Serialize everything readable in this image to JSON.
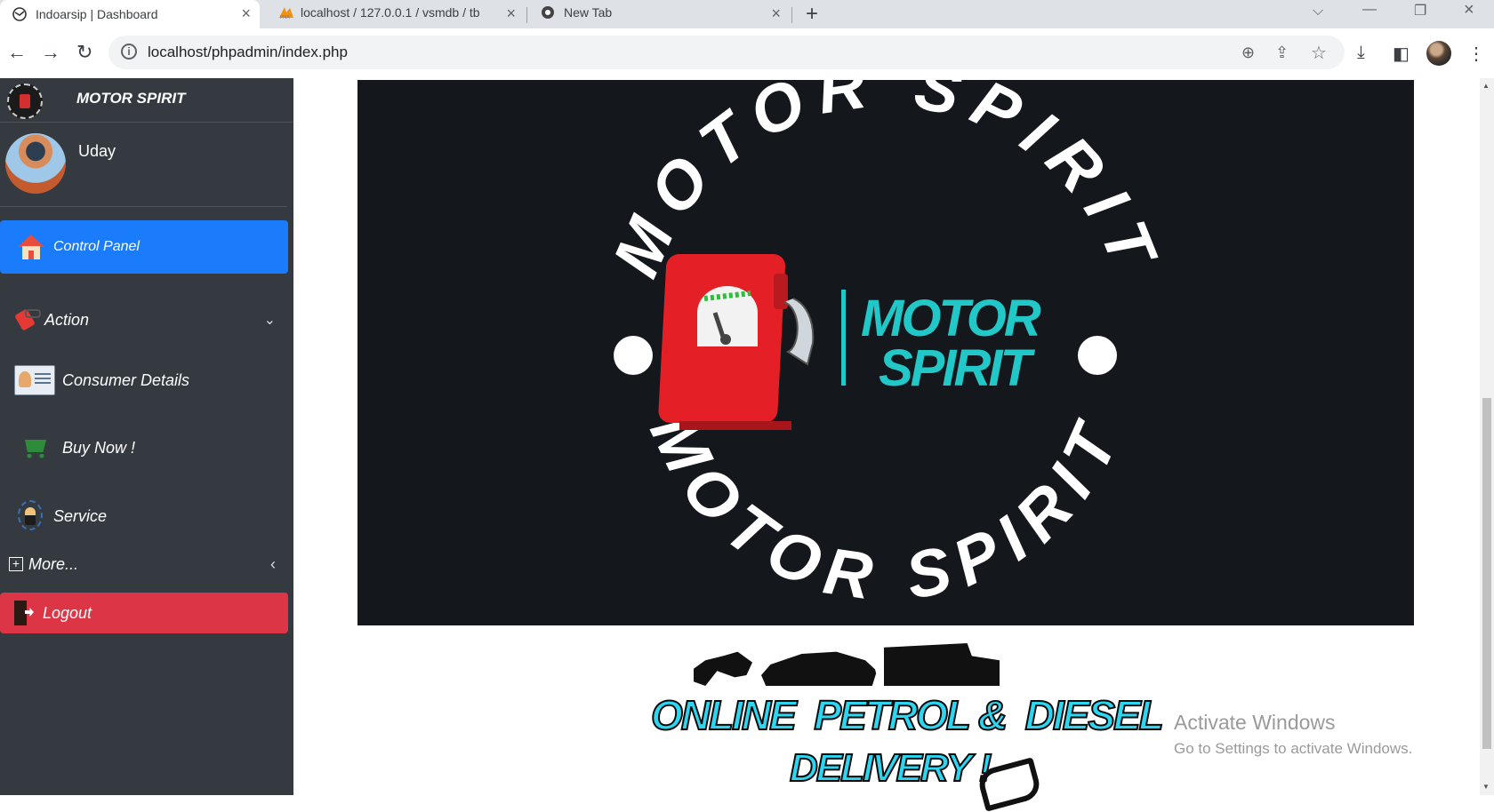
{
  "browser": {
    "tabs": [
      {
        "title": "Indoarsip | Dashboard",
        "active": true
      },
      {
        "title": "localhost / 127.0.0.1 / vsmdb / tb",
        "active": false
      },
      {
        "title": "New Tab",
        "active": false
      }
    ],
    "url": "localhost/phpadmin/index.php"
  },
  "sidebar": {
    "brand": "MOTOR SPIRIT",
    "user_name": "Uday",
    "items": [
      {
        "label": "Control Panel",
        "icon": "house-icon"
      },
      {
        "label": "Action",
        "icon": "fuel-pump-icon"
      },
      {
        "label": "Consumer Details",
        "icon": "id-card-icon"
      },
      {
        "label": "Buy Now !",
        "icon": "cart-icon"
      },
      {
        "label": "Service",
        "icon": "service-person-icon"
      },
      {
        "label": "More...",
        "icon": "plus-square-icon"
      },
      {
        "label": "Logout",
        "icon": "exit-door-icon"
      }
    ]
  },
  "banner": {
    "ring_top": "MOTOR SPIRIT",
    "ring_bottom": "MOTOR SPIRIT",
    "center_line1": "MOTOR",
    "center_line2": "SPIRIT",
    "accent": "#22c7c7",
    "pump_color": "#e41f26"
  },
  "promo": {
    "line1": "ONLINE  PETROL &  DIESEL",
    "line2": "DELIVERY !"
  },
  "windows_notice": {
    "title": "Activate Windows",
    "subtitle": "Go to Settings to activate Windows."
  },
  "colors": {
    "sidebar_bg": "#343a40",
    "active_item": "#1a7cfb",
    "logout": "#dc3545",
    "promo_text": "#2cd5f0"
  }
}
